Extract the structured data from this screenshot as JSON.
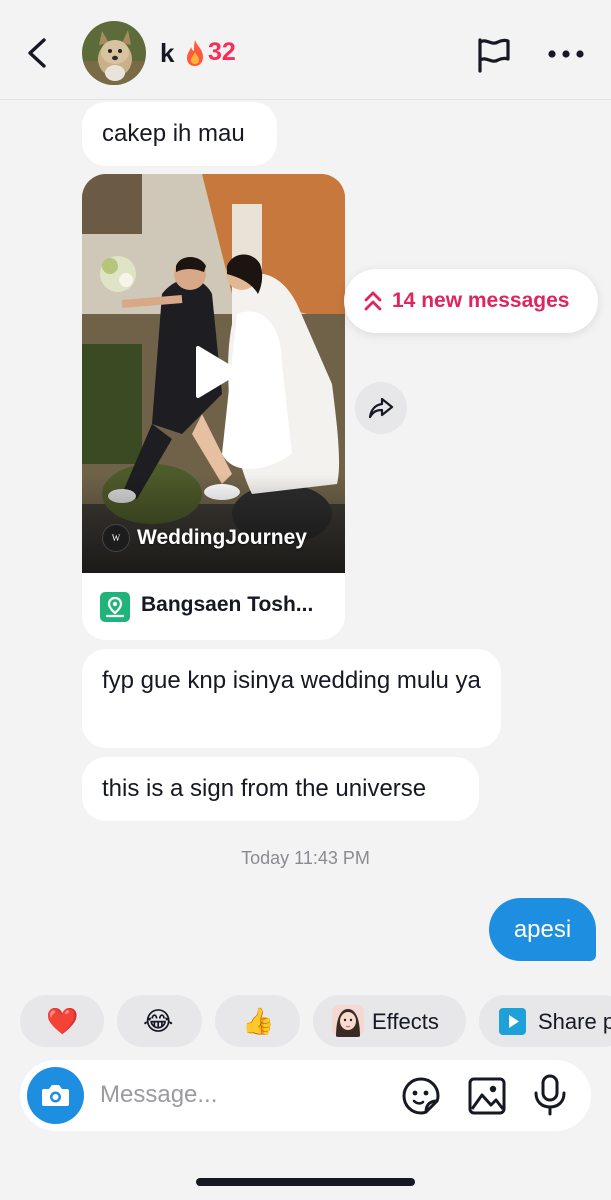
{
  "header": {
    "username": "k",
    "streak_count": "32",
    "icons": {
      "back": "chevron-left-icon",
      "streak": "fire-icon",
      "report": "flag-icon",
      "more": "more-horizontal-icon"
    }
  },
  "messages": {
    "msg1": "cakep ih mau",
    "shared_video": {
      "account": "WeddingJourney",
      "account_logo_text": "W",
      "location": "Bangsaen Tosh..."
    },
    "msg2": "fyp gue knp isinya wedding mulu ya",
    "msg3": "this is a sign from the universe",
    "timestamp": "Today 11:43 PM",
    "outgoing1": "apesi"
  },
  "new_messages_pill": {
    "label": "14 new messages"
  },
  "quick_reactions": [
    {
      "emoji": "❤️"
    },
    {
      "emoji": "😂"
    },
    {
      "emoji": "👍"
    },
    {
      "label": "Effects"
    },
    {
      "label": "Share p"
    }
  ],
  "composer": {
    "placeholder": "Message..."
  },
  "colors": {
    "accent_pink": "#fe2c55",
    "outgoing_bubble": "#1e8fe0",
    "background": "#f3f3f4",
    "location_green": "#20b47a"
  }
}
